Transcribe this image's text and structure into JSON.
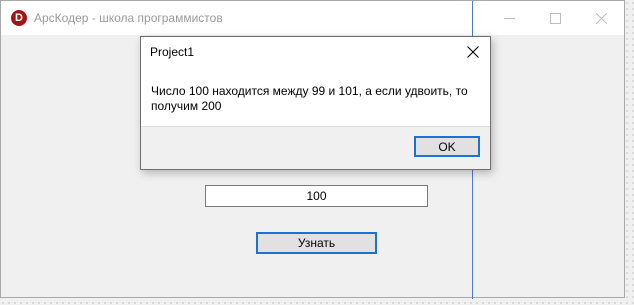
{
  "window": {
    "title": "АрсКодер - школа программистов",
    "icon_letter": "D"
  },
  "form": {
    "input_value": "100",
    "button_label": "Узнать"
  },
  "dialog": {
    "title": "Project1",
    "message": "Число 100 находится между 99 и 101, а если удвоить, то получим 200",
    "ok_label": "OK"
  },
  "colors": {
    "accent": "#1a73d3",
    "app_icon": "#a31515"
  }
}
